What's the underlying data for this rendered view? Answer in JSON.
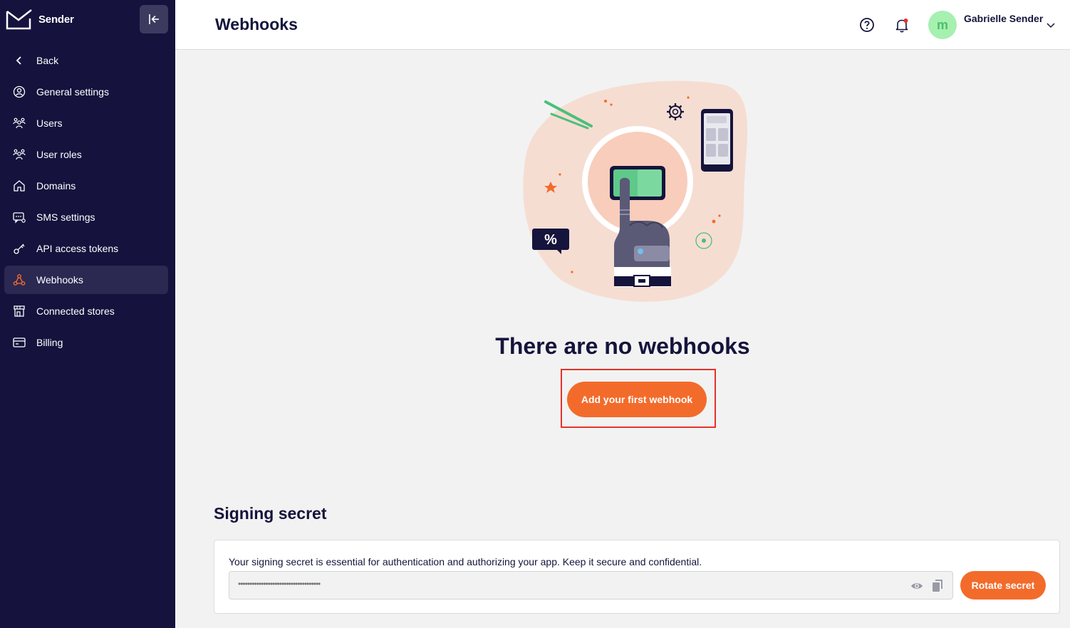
{
  "brand": {
    "name": "Sender"
  },
  "sidebar": {
    "items": [
      {
        "label": "Back",
        "icon": "chevron-left-icon"
      },
      {
        "label": "General settings",
        "icon": "user-circle-icon"
      },
      {
        "label": "Users",
        "icon": "users-icon"
      },
      {
        "label": "User roles",
        "icon": "user-roles-icon"
      },
      {
        "label": "Domains",
        "icon": "home-icon"
      },
      {
        "label": "SMS settings",
        "icon": "sms-icon"
      },
      {
        "label": "API access tokens",
        "icon": "key-icon"
      },
      {
        "label": "Webhooks",
        "icon": "webhook-icon",
        "active": true
      },
      {
        "label": "Connected stores",
        "icon": "store-icon"
      },
      {
        "label": "Billing",
        "icon": "credit-card-icon"
      }
    ]
  },
  "header": {
    "title": "Webhooks",
    "user": {
      "name": "Gabrielle Sender",
      "initial": "m"
    }
  },
  "empty_state": {
    "title": "There are no webhooks",
    "button": "Add your first webhook"
  },
  "signing": {
    "title": "Signing secret",
    "description": "Your signing secret is essential for authentication and authorizing your app. Keep it secure and confidential.",
    "secret_masked": "••••••••••••••••••••••••••••••••••••",
    "rotate_button": "Rotate secret"
  },
  "colors": {
    "sidebar_bg": "#15123d",
    "accent": "#f36b2b",
    "active_icon": "#f36b2b",
    "avatar_bg": "#a6f0b0"
  }
}
